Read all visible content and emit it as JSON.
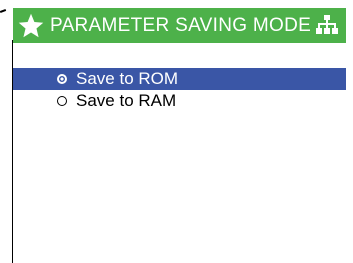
{
  "header": {
    "title": "PARAMETER SAVING MODE",
    "icons": [
      "star-icon",
      "hierarchy-icon"
    ]
  },
  "options": [
    {
      "label": "Save to ROM",
      "selected": true
    },
    {
      "label": "Save to RAM",
      "selected": false
    }
  ],
  "colors": {
    "header_bg": "#4db14a",
    "selection_bg": "#3a56a6"
  }
}
